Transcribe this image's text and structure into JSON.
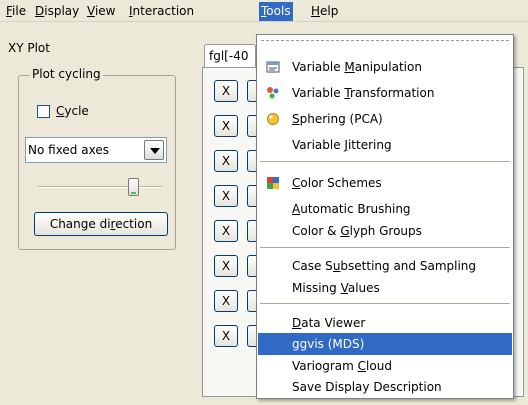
{
  "menubar": {
    "items": [
      {
        "pre": "",
        "u": "F",
        "post": "ile"
      },
      {
        "pre": "",
        "u": "D",
        "post": "isplay"
      },
      {
        "pre": "",
        "u": "V",
        "post": "iew"
      },
      {
        "pre": "",
        "u": "I",
        "post": "nteraction"
      },
      {
        "pre": "",
        "u": "T",
        "post": "ools"
      },
      {
        "pre": "",
        "u": "H",
        "post": "elp"
      }
    ],
    "active": "Tools"
  },
  "left_panel": {
    "title": "XY Plot",
    "group_label": "Plot cycling",
    "cycle_checkbox": {
      "pre": "",
      "u": "C",
      "post": "ycle",
      "checked": false
    },
    "axes_combo": {
      "value": "No fixed axes"
    },
    "slider": {
      "level": 0.82
    },
    "change_direction_button": {
      "pre": "Change di",
      "u": "r",
      "post": "ection"
    }
  },
  "right_panel": {
    "tab_label": "fgl[-40",
    "x_button_label": "X",
    "x_button_count": 8
  },
  "tools_menu": {
    "items": [
      {
        "pre": "Variable ",
        "u": "M",
        "post": "anipulation",
        "icon": "variable-manipulation-icon"
      },
      {
        "pre": "Variable ",
        "u": "T",
        "post": "ransformation",
        "icon": "variable-transformation-icon"
      },
      {
        "pre": "",
        "u": "S",
        "post": "phering (PCA)",
        "icon": "sphering-icon"
      },
      {
        "pre": "Variable ",
        "u": "J",
        "post": "ittering",
        "icon": ""
      },
      {
        "pre": "",
        "u": "C",
        "post": "olor Schemes",
        "icon": "color-schemes-icon"
      },
      {
        "pre": "",
        "u": "A",
        "post": "utomatic Brushing",
        "icon": ""
      },
      {
        "pre": "Color & ",
        "u": "G",
        "post": "lyph Groups",
        "icon": ""
      },
      {
        "pre": "Case S",
        "u": "u",
        "post": "bsetting and Sampling",
        "icon": ""
      },
      {
        "pre": "Missing ",
        "u": "V",
        "post": "alues",
        "icon": ""
      },
      {
        "pre": "",
        "u": "D",
        "post": "ata Viewer",
        "icon": ""
      },
      {
        "pre": "ggvis (MDS)",
        "u": "",
        "post": "",
        "icon": "",
        "highlighted": true
      },
      {
        "pre": "Variogram ",
        "u": "C",
        "post": "loud",
        "icon": ""
      },
      {
        "pre": "Save Display Description",
        "u": "",
        "post": "",
        "icon": ""
      }
    ]
  },
  "colors": {
    "highlight": "#316ac5",
    "window_bg": "#ece9d8"
  }
}
